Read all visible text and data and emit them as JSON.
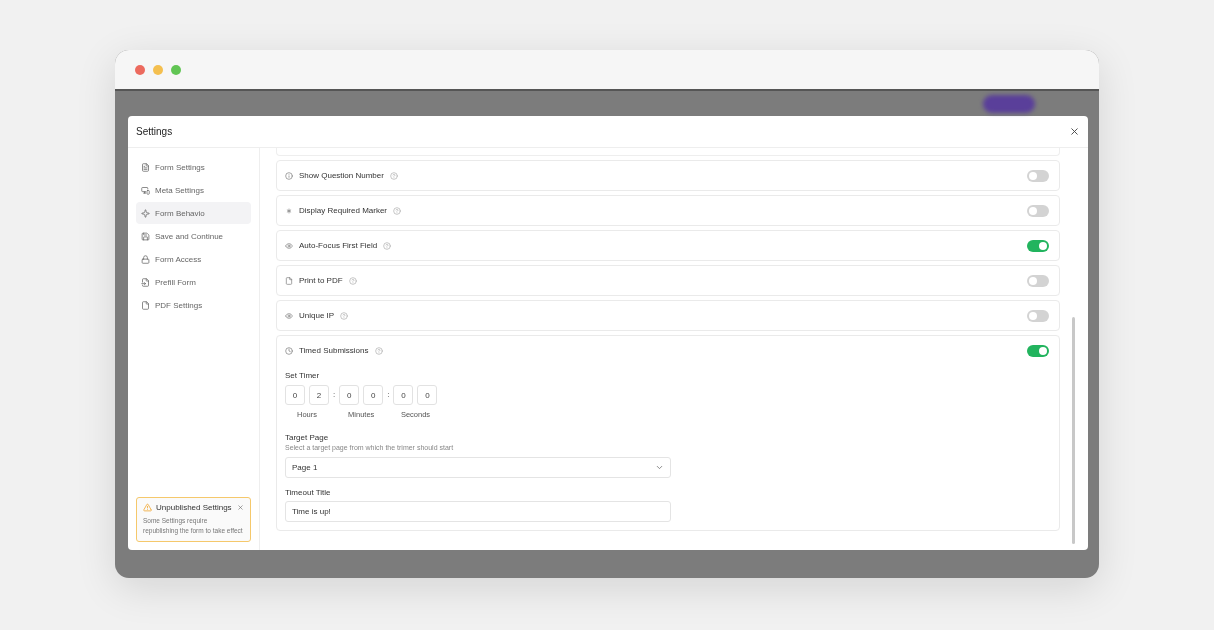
{
  "dialog": {
    "title": "Settings"
  },
  "sidebar": {
    "items": [
      {
        "label": "Form Settings",
        "selected": false
      },
      {
        "label": "Meta Settings",
        "selected": false
      },
      {
        "label": "Form Behavio",
        "selected": true
      },
      {
        "label": "Save and Continue",
        "selected": false
      },
      {
        "label": "Form Access",
        "selected": false
      },
      {
        "label": "Prefill Form",
        "selected": false
      },
      {
        "label": "PDF Settings",
        "selected": false
      }
    ]
  },
  "notice": {
    "title": "Unpublished Settings",
    "text": "Some Settings require republishing the form to take effect"
  },
  "settings": [
    {
      "label": "Show Question Number",
      "on": false
    },
    {
      "label": "Display Required Marker",
      "on": false
    },
    {
      "label": "Auto-Focus First Field",
      "on": true
    },
    {
      "label": "Print to PDF",
      "on": false
    },
    {
      "label": "Unique IP",
      "on": false
    },
    {
      "label": "Timed Submissions",
      "on": true
    }
  ],
  "timer": {
    "label": "Set Timer",
    "groups": [
      {
        "digits": [
          "0",
          "2"
        ],
        "unit": "Hours"
      },
      {
        "digits": [
          "0",
          "0"
        ],
        "unit": "Minutes"
      },
      {
        "digits": [
          "0",
          "0"
        ],
        "unit": "Seconds"
      }
    ],
    "separator": ":"
  },
  "target_page": {
    "label": "Target Page",
    "hint": "Select a target page from which the trimer should start",
    "value": "Page 1"
  },
  "timeout_title": {
    "label": "Timeout Title",
    "value": "Time is up!"
  }
}
